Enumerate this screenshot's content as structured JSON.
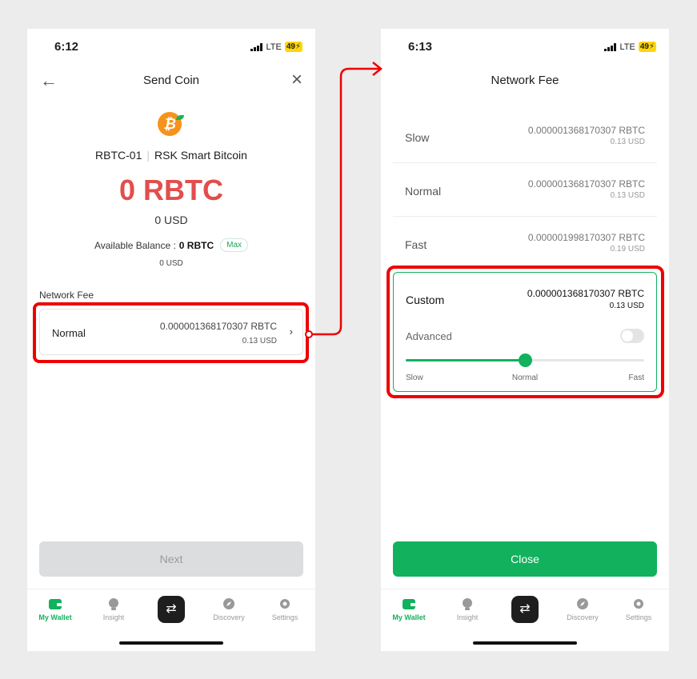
{
  "left_screen": {
    "status": {
      "time": "6:12",
      "network": "LTE",
      "battery": "49"
    },
    "title": "Send Coin",
    "coin": {
      "symbol_glyph": "₿",
      "code": "RBTC-01",
      "name": "RSK Smart Bitcoin"
    },
    "amount": "0 RBTC",
    "amount_usd": "0 USD",
    "balance": {
      "label": "Available Balance :",
      "value": "0 RBTC",
      "max_label": "Max",
      "usd": "0 USD"
    },
    "network_fee_label": "Network Fee",
    "selected_fee": {
      "name": "Normal",
      "rbtc": "0.000001368170307 RBTC",
      "usd": "0.13 USD"
    },
    "next_label": "Next"
  },
  "right_screen": {
    "status": {
      "time": "6:13",
      "network": "LTE",
      "battery": "49"
    },
    "title": "Network Fee",
    "options": [
      {
        "name": "Slow",
        "rbtc": "0.000001368170307 RBTC",
        "usd": "0.13 USD"
      },
      {
        "name": "Normal",
        "rbtc": "0.000001368170307 RBTC",
        "usd": "0.13 USD"
      },
      {
        "name": "Fast",
        "rbtc": "0.000001998170307 RBTC",
        "usd": "0.19 USD"
      }
    ],
    "custom": {
      "name": "Custom",
      "rbtc": "0.000001368170307 RBTC",
      "usd": "0.13 USD",
      "advanced_label": "Advanced",
      "advanced_on": false,
      "slider": {
        "min_label": "Slow",
        "mid_label": "Normal",
        "max_label": "Fast",
        "level": 0.5
      }
    },
    "close_label": "Close"
  },
  "tabbar": {
    "items": [
      {
        "label": "My Wallet",
        "icon": "wallet-icon",
        "active": true
      },
      {
        "label": "Insight",
        "icon": "insight-icon",
        "active": false
      },
      {
        "label": "",
        "icon": "swap-icon",
        "active": false
      },
      {
        "label": "Discovery",
        "icon": "compass-icon",
        "active": false
      },
      {
        "label": "Settings",
        "icon": "gear-icon",
        "active": false
      }
    ]
  },
  "colors": {
    "accent": "#12b15d",
    "amount": "#e34d4d",
    "highlight": "#ee0000",
    "coin": "#f7931a"
  }
}
